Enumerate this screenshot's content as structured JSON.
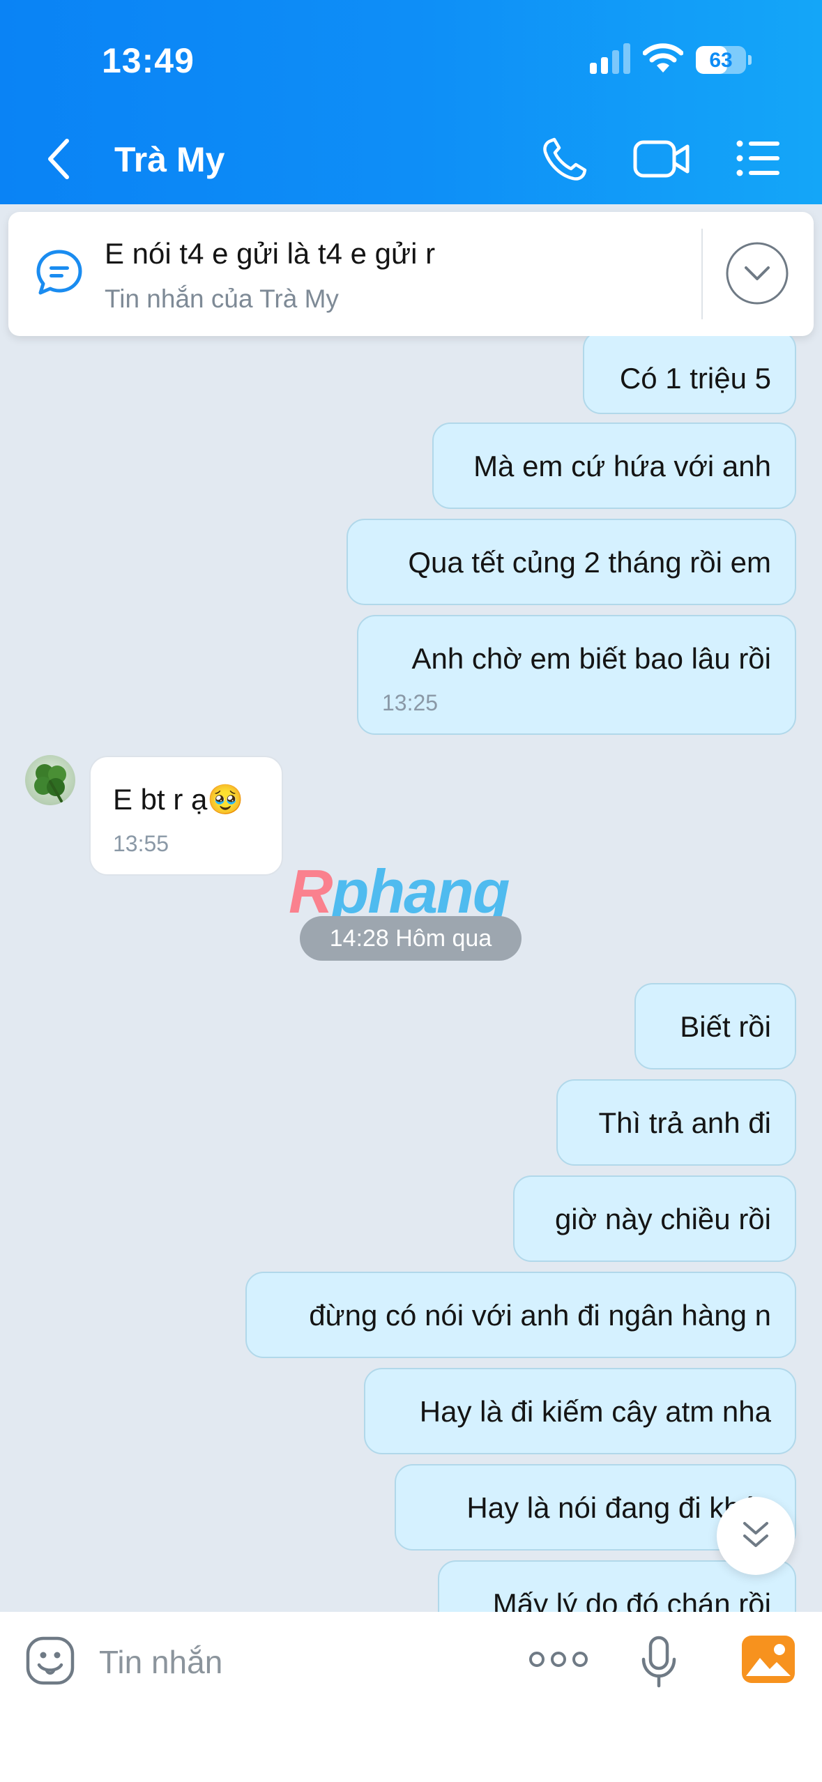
{
  "status_bar": {
    "time": "13:49",
    "battery": "63"
  },
  "header": {
    "contact_name": "Trà My"
  },
  "pinned": {
    "title": "E nói t4 e gửi là t4 e gửi r",
    "subtitle": "Tin nhắn của Trà My"
  },
  "messages": [
    {
      "text": "Có 1 triệu 5"
    },
    {
      "text": "Mà em cứ hứa với anh"
    },
    {
      "text": "Qua tết củng 2 tháng rồi em"
    },
    {
      "text": "Anh chờ em biết bao lâu rồi",
      "time": "13:25"
    },
    {
      "text": "E bt r ạ🥹",
      "time": "13:55"
    },
    {
      "text": "Biết rồi"
    },
    {
      "text": "Thì trả anh đi"
    },
    {
      "text": "giờ này chiều rồi"
    },
    {
      "text": "đừng có nói với anh đi ngân hàng n"
    },
    {
      "text": "Hay là đi kiếm cây atm nha"
    },
    {
      "text": "Hay là nói đang đi khác"
    },
    {
      "text": "Mấy lý do đó chán rồi"
    }
  ],
  "date_separator": "14:28 Hôm qua",
  "watermark": {
    "first": "R",
    "rest": "phang"
  },
  "composer": {
    "placeholder": "Tin nhắn"
  },
  "colors": {
    "header_start": "#0a83f5",
    "header_end": "#14a6f8",
    "outgoing_bubble": "#d5f1ff",
    "chat_background": "#e2e9f1"
  }
}
